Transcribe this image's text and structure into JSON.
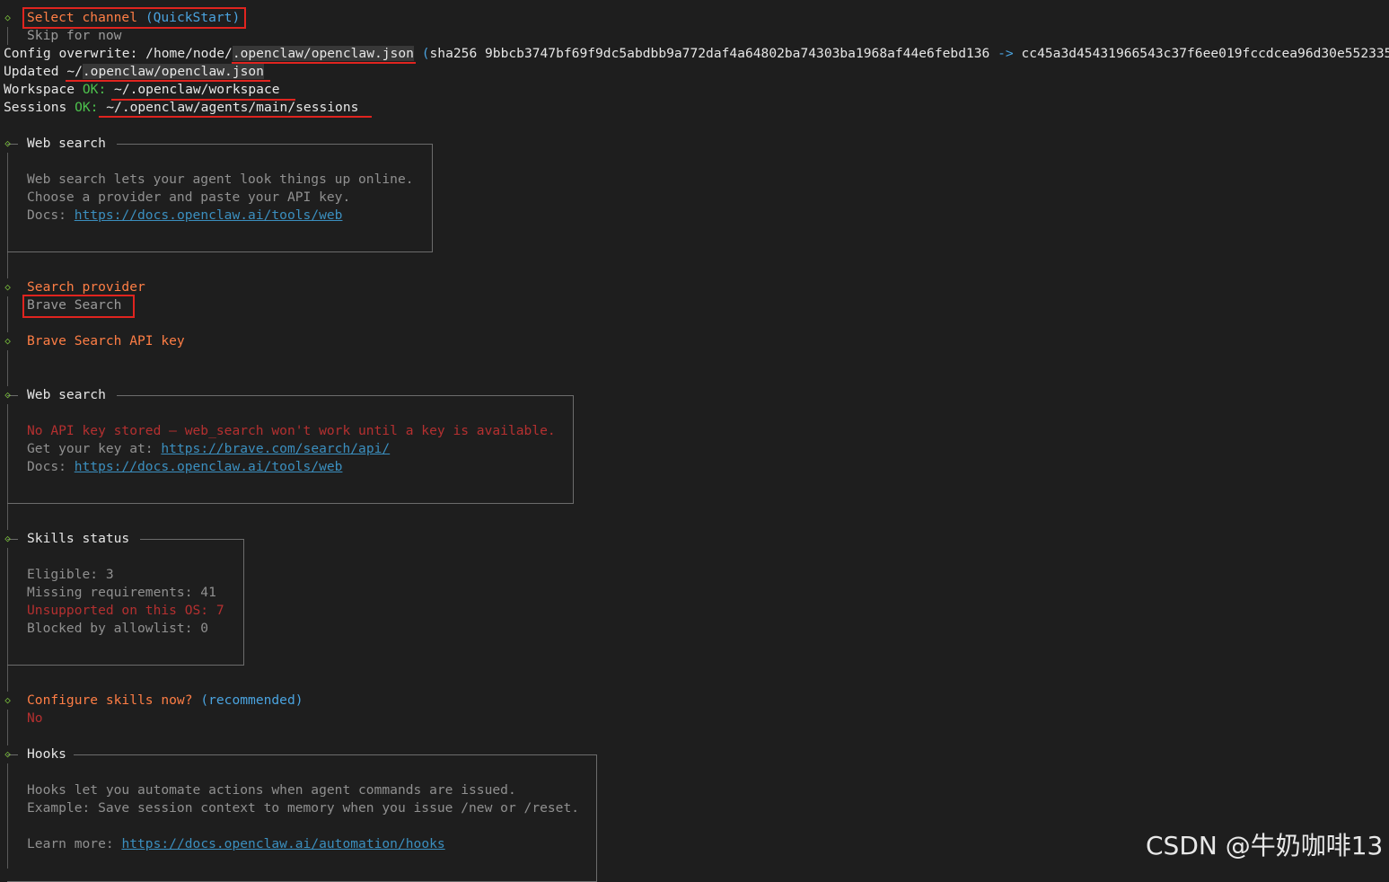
{
  "channel": {
    "title": "Select channel",
    "mode": "(QuickStart)",
    "value": "Skip for now"
  },
  "config": {
    "label": "Config overwrite:",
    "path_prefix": "/home/node/",
    "path_file": ".openclaw/openclaw.json",
    "hash_open": "(",
    "hash_label": "sha256 9bbcb3747bf69f9dc5abdbb9a772daf4a64802ba74303ba1968af44e6febd136",
    "arrow": "->",
    "hash_new": "cc45a3d45431966543c37f6ee019fccdcea96d30e552335"
  },
  "updated": {
    "label": "Updated",
    "path_prefix": "~/",
    "path_file": ".openclaw/openclaw.json"
  },
  "workspace": {
    "label": "Workspace",
    "ok": "OK:",
    "path": "~/.openclaw/workspace"
  },
  "sessions": {
    "label": "Sessions",
    "ok": "OK:",
    "path": "~/.openclaw/agents/main/sessions"
  },
  "web_search_1": {
    "title": "Web search",
    "line1": "Web search lets your agent look things up online.",
    "line2": "Choose a provider and paste your API key.",
    "docs_label": "Docs:",
    "docs_url": "https://docs.openclaw.ai/tools/web"
  },
  "search_provider": {
    "title": "Search provider",
    "value": "Brave Search"
  },
  "api_key": {
    "title": "Brave Search API key"
  },
  "web_search_2": {
    "title": "Web search",
    "warning": "No API key stored — web_search won't work until a key is available.",
    "get_key_label": "Get your key at:",
    "get_key_url": "https://brave.com/search/api/",
    "docs_label": "Docs:",
    "docs_url": "https://docs.openclaw.ai/tools/web"
  },
  "skills": {
    "title": "Skills status",
    "eligible": "Eligible: 3",
    "missing": "Missing requirements: 41",
    "unsupported": "Unsupported on this OS: 7",
    "blocked": "Blocked by allowlist: 0"
  },
  "configure_skills": {
    "title": "Configure skills now?",
    "note": "(recommended)",
    "value": "No"
  },
  "hooks": {
    "title": "Hooks",
    "line1": "Hooks let you automate actions when agent commands are issued.",
    "line2": "Example: Save session context to memory when you issue /new or /reset.",
    "learn_label": "Learn more:",
    "learn_url": "https://docs.openclaw.ai/automation/hooks"
  },
  "watermark": "CSDN @牛奶咖啡13",
  "colors": {
    "accent": "#ff7e45",
    "ok": "#4dc24d",
    "link": "#3b8fbf",
    "warning": "#b53030",
    "annotation": "#e0241f",
    "background": "#1e1e1e"
  }
}
